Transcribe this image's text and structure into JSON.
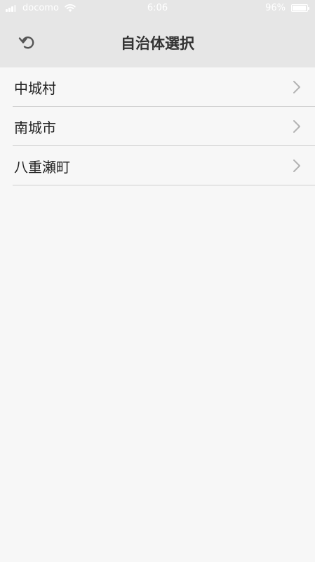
{
  "status_bar": {
    "carrier": "docomo",
    "time": "6:06",
    "battery_percent": "96%",
    "battery_level": 0.96,
    "signal_icon": "signal-bars-icon",
    "wifi_icon": "wifi-icon"
  },
  "header": {
    "title": "自治体選択",
    "back_icon": "undo-arrow-icon"
  },
  "municipalities": [
    {
      "label": "中城村",
      "icon": "chevron-right-icon"
    },
    {
      "label": "南城市",
      "icon": "chevron-right-icon"
    },
    {
      "label": "八重瀬町",
      "icon": "chevron-right-icon"
    }
  ],
  "colors": {
    "header_bg": "#e6e6e6",
    "page_bg": "#f7f7f7",
    "divider": "#cfcfcf",
    "chevron": "#b3b3b3"
  }
}
